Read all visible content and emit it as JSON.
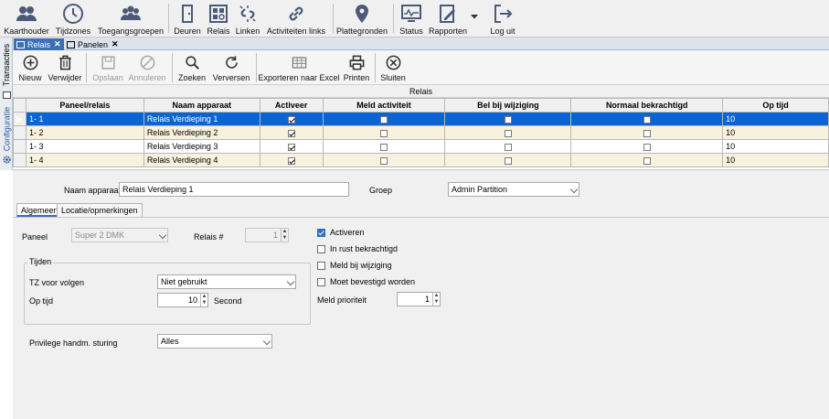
{
  "top_toolbar": {
    "items": [
      {
        "label": "Kaarthouder",
        "icon": "users-icon"
      },
      {
        "label": "Tijdzones",
        "icon": "clock-icon"
      },
      {
        "label": "Toegangsgroepen",
        "icon": "group-icon"
      },
      {
        "label": "Deuren",
        "icon": "door-icon"
      },
      {
        "label": "Relais",
        "icon": "relay-icon"
      },
      {
        "label": "Linken",
        "icon": "link-broken-icon"
      },
      {
        "label": "Activiteiten links",
        "icon": "chain-link-icon"
      },
      {
        "label": "Plattegronden",
        "icon": "map-pin-icon"
      },
      {
        "label": "Status",
        "icon": "monitor-icon"
      },
      {
        "label": "Rapporten",
        "icon": "report-icon"
      },
      {
        "label": "Log uit",
        "icon": "logout-icon"
      }
    ]
  },
  "document_tabs": [
    {
      "label": "Relais",
      "active": true
    },
    {
      "label": "Panelen",
      "active": false
    }
  ],
  "side_tabs": [
    {
      "label": "Transacties"
    },
    {
      "label": "Configuratie"
    }
  ],
  "action_toolbar": {
    "items": [
      {
        "label": "Nieuw",
        "icon": "plus-circle-icon",
        "enabled": true
      },
      {
        "label": "Verwijder",
        "icon": "trash-icon",
        "enabled": true
      },
      {
        "label": "Opslaan",
        "icon": "save-icon",
        "enabled": false
      },
      {
        "label": "Annuleren",
        "icon": "cancel-icon",
        "enabled": false
      },
      {
        "label": "Zoeken",
        "icon": "search-icon",
        "enabled": true
      },
      {
        "label": "Verversen",
        "icon": "refresh-icon",
        "enabled": true
      },
      {
        "label": "Exporteren naar Excel",
        "icon": "excel-icon",
        "enabled": true
      },
      {
        "label": "Printen",
        "icon": "printer-icon",
        "enabled": true
      },
      {
        "label": "Sluiten",
        "icon": "close-circle-icon",
        "enabled": true
      }
    ]
  },
  "grid": {
    "group_header": "Relais",
    "columns": [
      "Paneel/relais",
      "Naam apparaat",
      "Activeer",
      "Meld activiteit",
      "Bel bij wijziging",
      "Normaal bekrachtigd",
      "Op tijd"
    ],
    "rows": [
      {
        "paneel": "1- 1",
        "naam": "Relais Verdieping 1",
        "activeer": true,
        "meld": false,
        "bel": false,
        "normaal": false,
        "optijd": "10",
        "selected": true
      },
      {
        "paneel": "1- 2",
        "naam": "Relais Verdieping 2",
        "activeer": true,
        "meld": false,
        "bel": false,
        "normaal": false,
        "optijd": "10",
        "selected": false
      },
      {
        "paneel": "1- 3",
        "naam": "Relais Verdieping 3",
        "activeer": true,
        "meld": false,
        "bel": false,
        "normaal": false,
        "optijd": "10",
        "selected": false
      },
      {
        "paneel": "1- 4",
        "naam": "Relais Verdieping 4",
        "activeer": true,
        "meld": false,
        "bel": false,
        "normaal": false,
        "optijd": "10",
        "selected": false
      }
    ]
  },
  "form": {
    "naam_label": "Naam apparaat",
    "naam_value": "Relais Verdieping 1",
    "groep_label": "Groep",
    "groep_value": "Admin Partition",
    "subtabs": [
      "Algemeen",
      "Locatie/opmerkingen"
    ],
    "paneel_label": "Paneel",
    "paneel_value": "Super 2 DMK",
    "relais_label": "Relais #",
    "relais_value": "1",
    "tijden_label": "Tijden",
    "tz_label": "TZ voor volgen",
    "tz_value": "Niet gebruikt",
    "optijd_label": "Op tijd",
    "optijd_value": "10",
    "second_label": "Second",
    "privilege_label": "Privilege handm. sturing",
    "privilege_value": "Alles",
    "checkboxes": [
      {
        "label": "Activeren",
        "checked": true
      },
      {
        "label": "In rust bekrachtigd",
        "checked": false
      },
      {
        "label": "Meld bij wijziging",
        "checked": false
      },
      {
        "label": "Moet bevestigd worden",
        "checked": false
      }
    ],
    "meld_prioriteit_label": "Meld prioriteit",
    "meld_prioriteit_value": "1"
  },
  "colors": {
    "selection": "#0a64d4",
    "accent": "#3d6fb5",
    "row_alt": "#f6f2dd"
  }
}
